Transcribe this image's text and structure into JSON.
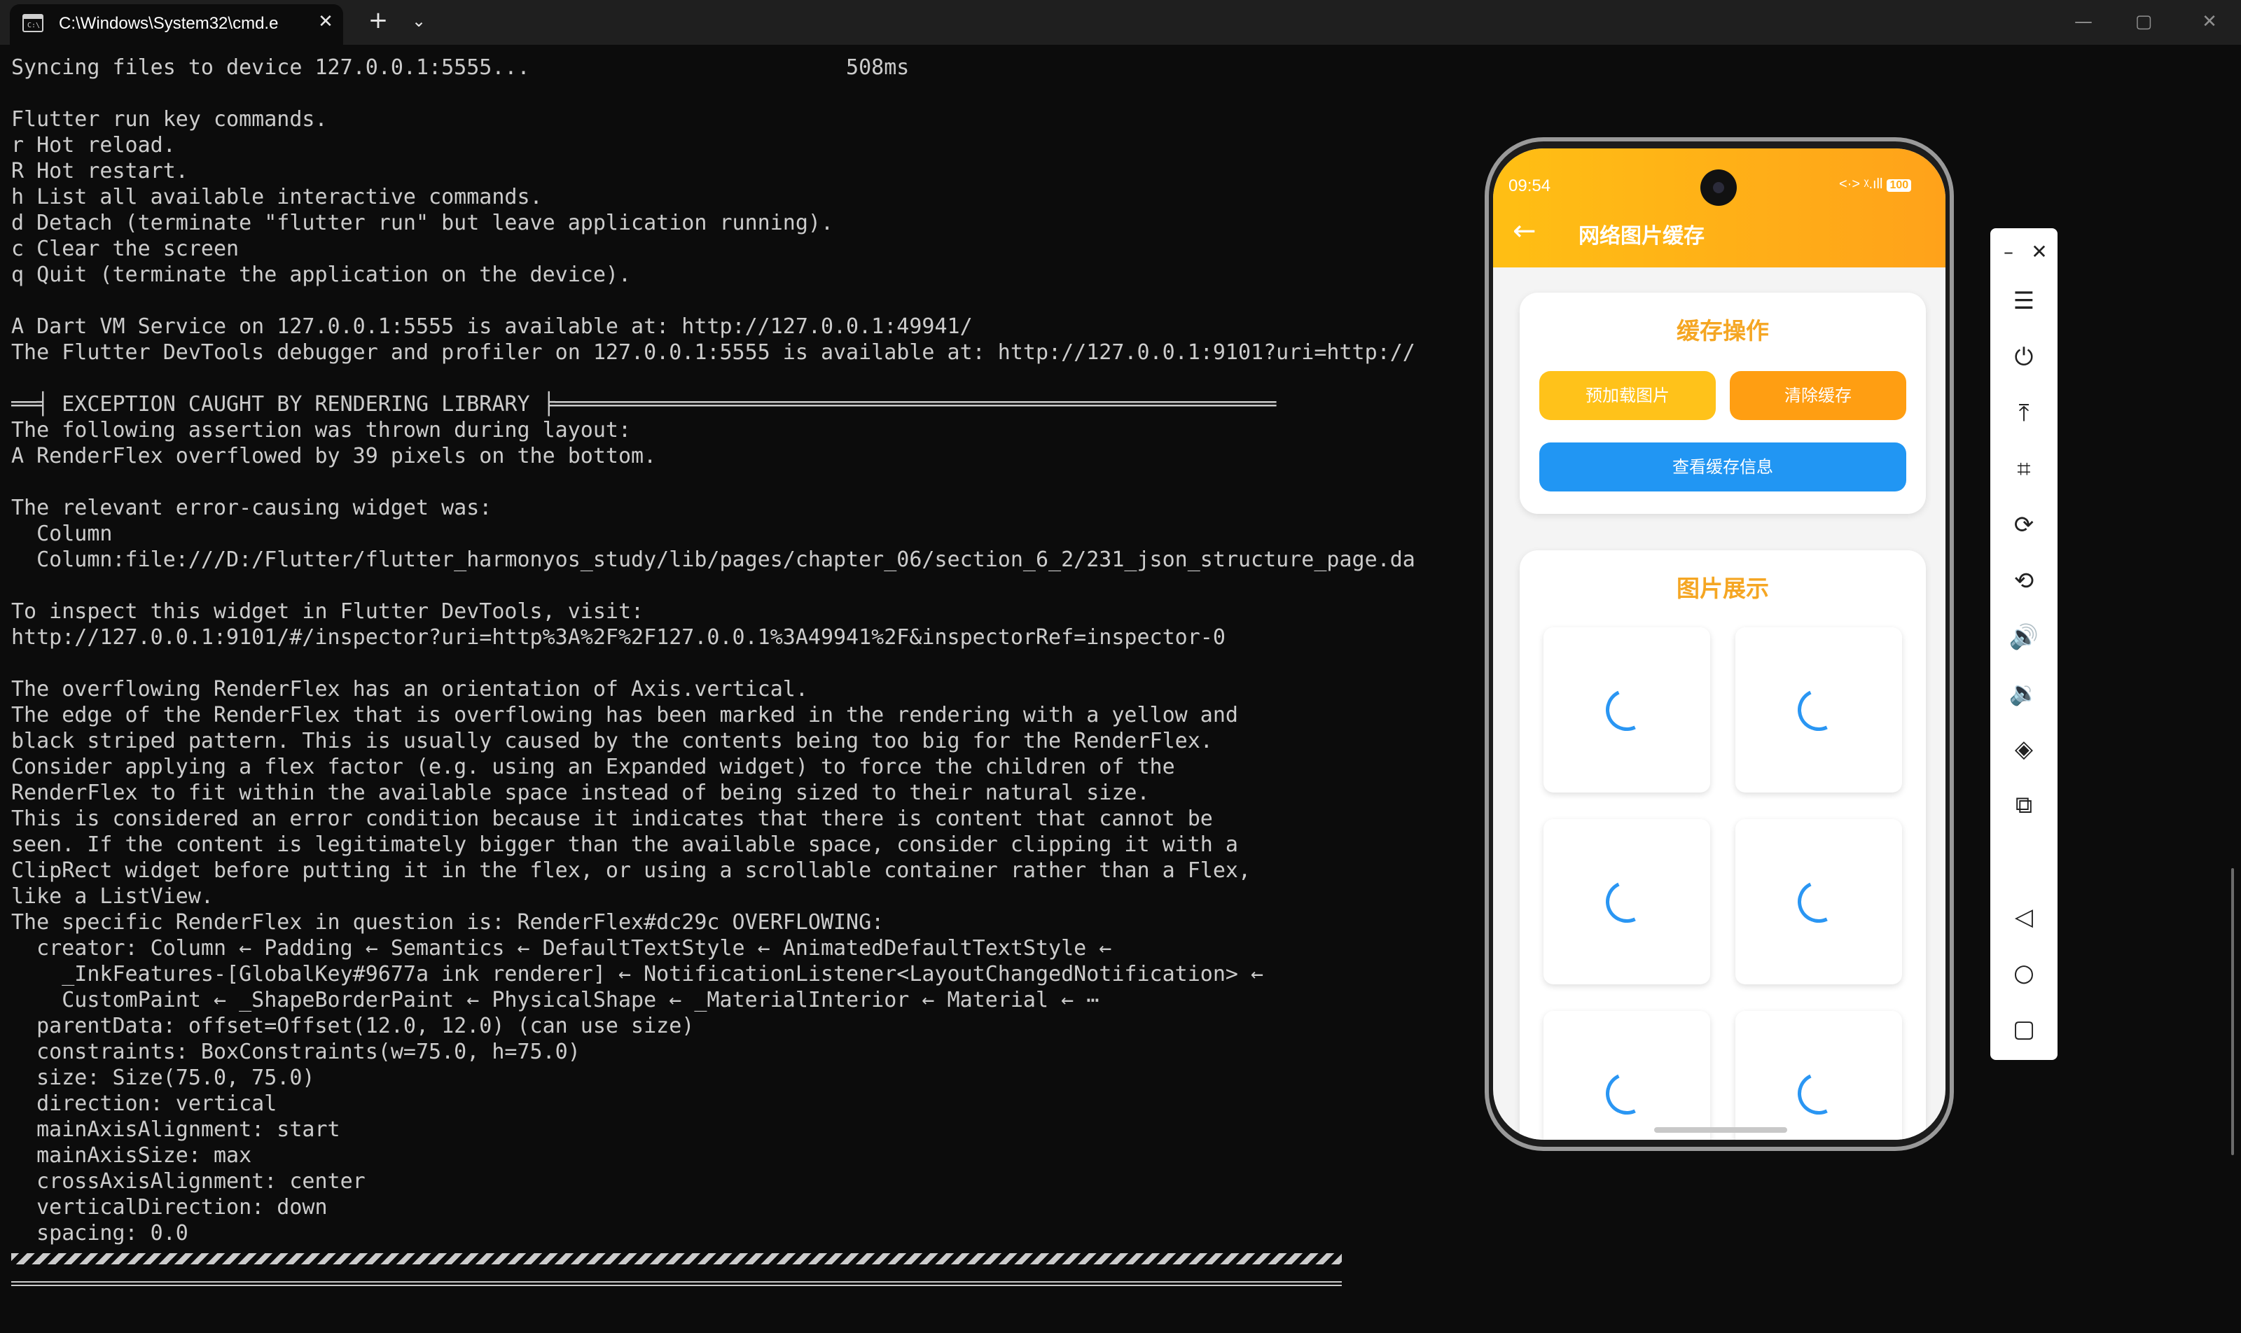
{
  "tab": {
    "icon": "cmd-terminal-icon",
    "title": "C:\\Windows\\System32\\cmd.e"
  },
  "window_controls": {
    "minimize": "—",
    "maximize": "▢",
    "close": "✕"
  },
  "terminal": {
    "lines": [
      "Syncing files to device 127.0.0.1:5555...                         508ms",
      "",
      "Flutter run key commands.",
      "r Hot reload.",
      "R Hot restart.",
      "h List all available interactive commands.",
      "d Detach (terminate \"flutter run\" but leave application running).",
      "c Clear the screen",
      "q Quit (terminate the application on the device).",
      "",
      "A Dart VM Service on 127.0.0.1:5555 is available at: http://127.0.0.1:49941/",
      "The Flutter DevTools debugger and profiler on 127.0.0.1:5555 is available at: http://127.0.0.1:9101?uri=http://",
      "",
      "══╡ EXCEPTION CAUGHT BY RENDERING LIBRARY ╞═════════════════════════════════════════════════════════",
      "The following assertion was thrown during layout:",
      "A RenderFlex overflowed by 39 pixels on the bottom.",
      "",
      "The relevant error-causing widget was:",
      "  Column",
      "  Column:file:///D:/Flutter/flutter_harmonyos_study/lib/pages/chapter_06/section_6_2/231_json_structure_page.da",
      "",
      "To inspect this widget in Flutter DevTools, visit:",
      "http://127.0.0.1:9101/#/inspector?uri=http%3A%2F%2F127.0.0.1%3A49941%2F&inspectorRef=inspector-0",
      "",
      "The overflowing RenderFlex has an orientation of Axis.vertical.",
      "The edge of the RenderFlex that is overflowing has been marked in the rendering with a yellow and",
      "black striped pattern. This is usually caused by the contents being too big for the RenderFlex.",
      "Consider applying a flex factor (e.g. using an Expanded widget) to force the children of the",
      "RenderFlex to fit within the available space instead of being sized to their natural size.",
      "This is considered an error condition because it indicates that there is content that cannot be",
      "seen. If the content is legitimately bigger than the available space, consider clipping it with a",
      "ClipRect widget before putting it in the flex, or using a scrollable container rather than a Flex,",
      "like a ListView.",
      "The specific RenderFlex in question is: RenderFlex#dc29c OVERFLOWING:",
      "  creator: Column ← Padding ← Semantics ← DefaultTextStyle ← AnimatedDefaultTextStyle ←",
      "    _InkFeatures-[GlobalKey#9677a ink renderer] ← NotificationListener<LayoutChangedNotification> ←",
      "    CustomPaint ← _ShapeBorderPaint ← PhysicalShape ← _MaterialInterior ← Material ← ⋯",
      "  parentData: offset=Offset(12.0, 12.0) (can use size)",
      "  constraints: BoxConstraints(w=75.0, h=75.0)",
      "  size: Size(75.0, 75.0)",
      "  direction: vertical",
      "  mainAxisAlignment: start",
      "  mainAxisSize: max",
      "  crossAxisAlignment: center",
      "  verticalDirection: down",
      "  spacing: 0.0"
    ]
  },
  "phone": {
    "status": {
      "time": "09:54",
      "signal": "<·> ᵡ.ıll",
      "battery": "100"
    },
    "appbar": {
      "back_icon": "arrow-back-icon",
      "title": "网络图片缓存"
    },
    "cache_card": {
      "title": "缓存操作",
      "preload_button": "预加载图片",
      "clear_button": "清除缓存",
      "info_button": "查看缓存信息"
    },
    "gallery_card": {
      "title": "图片展示",
      "tile_count": 6
    }
  },
  "colors": {
    "terminal_bg": "#0c0c0c",
    "terminal_text": "#cccccc",
    "appbar": "#ffb31a",
    "preload": "#ffc21a",
    "clear": "#ff9e12",
    "info": "#2196f3",
    "accent_title": "#f5a623"
  },
  "toolbar": {
    "items": [
      "minimize-icon",
      "close-icon",
      "menu-icon",
      "power-icon",
      "upload-icon",
      "crop-icon",
      "rotate-icon",
      "rotate-ccw-icon",
      "volume-up-icon",
      "volume-down-icon",
      "screenshot-icon",
      "multi-device-icon",
      "nav-back-icon",
      "nav-home-icon",
      "nav-recent-icon"
    ]
  }
}
